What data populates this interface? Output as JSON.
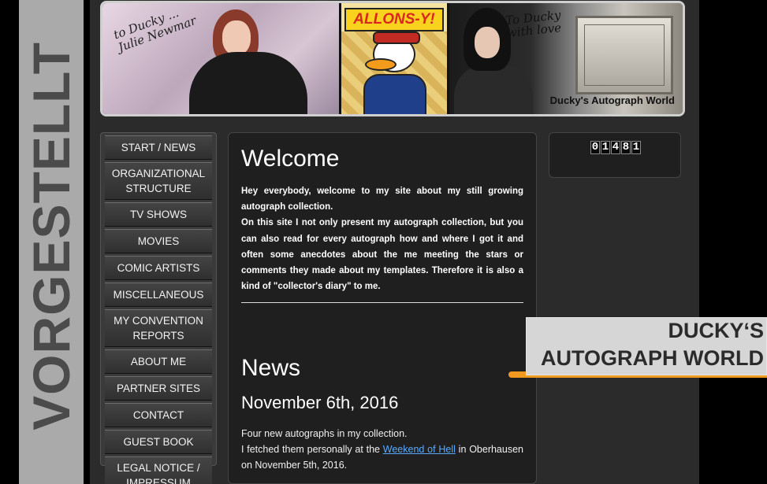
{
  "vertical_label": "VORGESTELLT",
  "banner": {
    "signature_left": "to Ducky ... Julie Newmar",
    "comic_title": "ALLONS-Y!",
    "signature_right": "To Ducky with love",
    "caption": "Ducky's Autograph World"
  },
  "nav": {
    "items": [
      {
        "label": "START / NEWS"
      },
      {
        "label": "ORGANIZATIONAL STRUCTURE"
      },
      {
        "label": "TV SHOWS"
      },
      {
        "label": "MOVIES"
      },
      {
        "label": "COMIC ARTISTS"
      },
      {
        "label": "MISCELLANEOUS"
      },
      {
        "label": "MY CONVENTION REPORTS"
      },
      {
        "label": "ABOUT ME"
      },
      {
        "label": "PARTNER SITES"
      },
      {
        "label": "CONTACT"
      },
      {
        "label": "GUEST BOOK"
      },
      {
        "label": "LEGAL NOTICE / IMPRESSUM"
      }
    ]
  },
  "content": {
    "welcome_title": "Welcome",
    "welcome_p1": "Hey everybody, welcome to my site about my still growing autograph collection.",
    "welcome_p2": "On this site I not only present my autograph collection, but you can also read for every autograph how and where I got it and often some anecdotes about the me meeting the stars or comments they made about my templates. Therefore it is also a kind of \"collector's diary\" to me.",
    "news_title": "News",
    "news_date": "November 6th, 2016",
    "news_line1": "Four new autographs in my collection.",
    "news_line2_pre": "I fetched them personally at the ",
    "news_link": "Weekend of Hell",
    "news_line2_post": " in Oberhausen on November 5th, 2016."
  },
  "counter": {
    "digits": [
      "0",
      "1",
      "4",
      "8",
      "1"
    ]
  },
  "overlay": {
    "line1": "DUCKY‘S",
    "line2": "AUTOGRAPH WORLD",
    "accent_color": "#f29a1f"
  }
}
